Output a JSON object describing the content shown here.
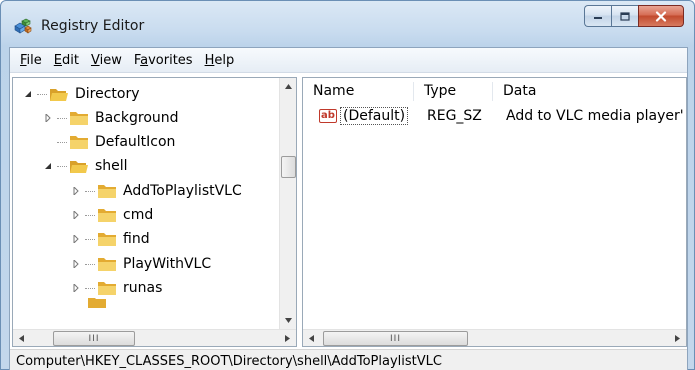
{
  "window": {
    "title": "Registry Editor",
    "app_icon": "registry-cubes-icon"
  },
  "menu": [
    {
      "label": "File",
      "accel": "F",
      "rest": "ile"
    },
    {
      "label": "Edit",
      "accel": "E",
      "rest": "dit"
    },
    {
      "label": "View",
      "accel": "V",
      "rest": "iew"
    },
    {
      "label": "Favorites",
      "pre": "F",
      "accel": "a",
      "rest": "vorites"
    },
    {
      "label": "Help",
      "accel": "H",
      "rest": "elp"
    }
  ],
  "tree": {
    "items": [
      {
        "label": "Directory",
        "expanded": true
      },
      {
        "label": "Background",
        "expanded": false
      },
      {
        "label": "DefaultIcon",
        "expanded": null
      },
      {
        "label": "shell",
        "expanded": true
      },
      {
        "label": "AddToPlaylistVLC",
        "expanded": false
      },
      {
        "label": "cmd",
        "expanded": false
      },
      {
        "label": "find",
        "expanded": false
      },
      {
        "label": "PlayWithVLC",
        "expanded": false
      },
      {
        "label": "runas",
        "expanded": false
      }
    ]
  },
  "list": {
    "columns": [
      "Name",
      "Type",
      "Data"
    ],
    "rows": [
      {
        "name": "(Default)",
        "type": "REG_SZ",
        "data": "Add to VLC media player'",
        "icon": "string-value-ab-icon"
      }
    ]
  },
  "scrollbar": {
    "thumb_glyph": "III"
  },
  "status": {
    "path": "Computer\\HKEY_CLASSES_ROOT\\Directory\\shell\\AddToPlaylistVLC"
  },
  "colors": {
    "folder": "#e8b53a",
    "string_icon": "#c0392b",
    "close_button": "#c24a2e"
  }
}
